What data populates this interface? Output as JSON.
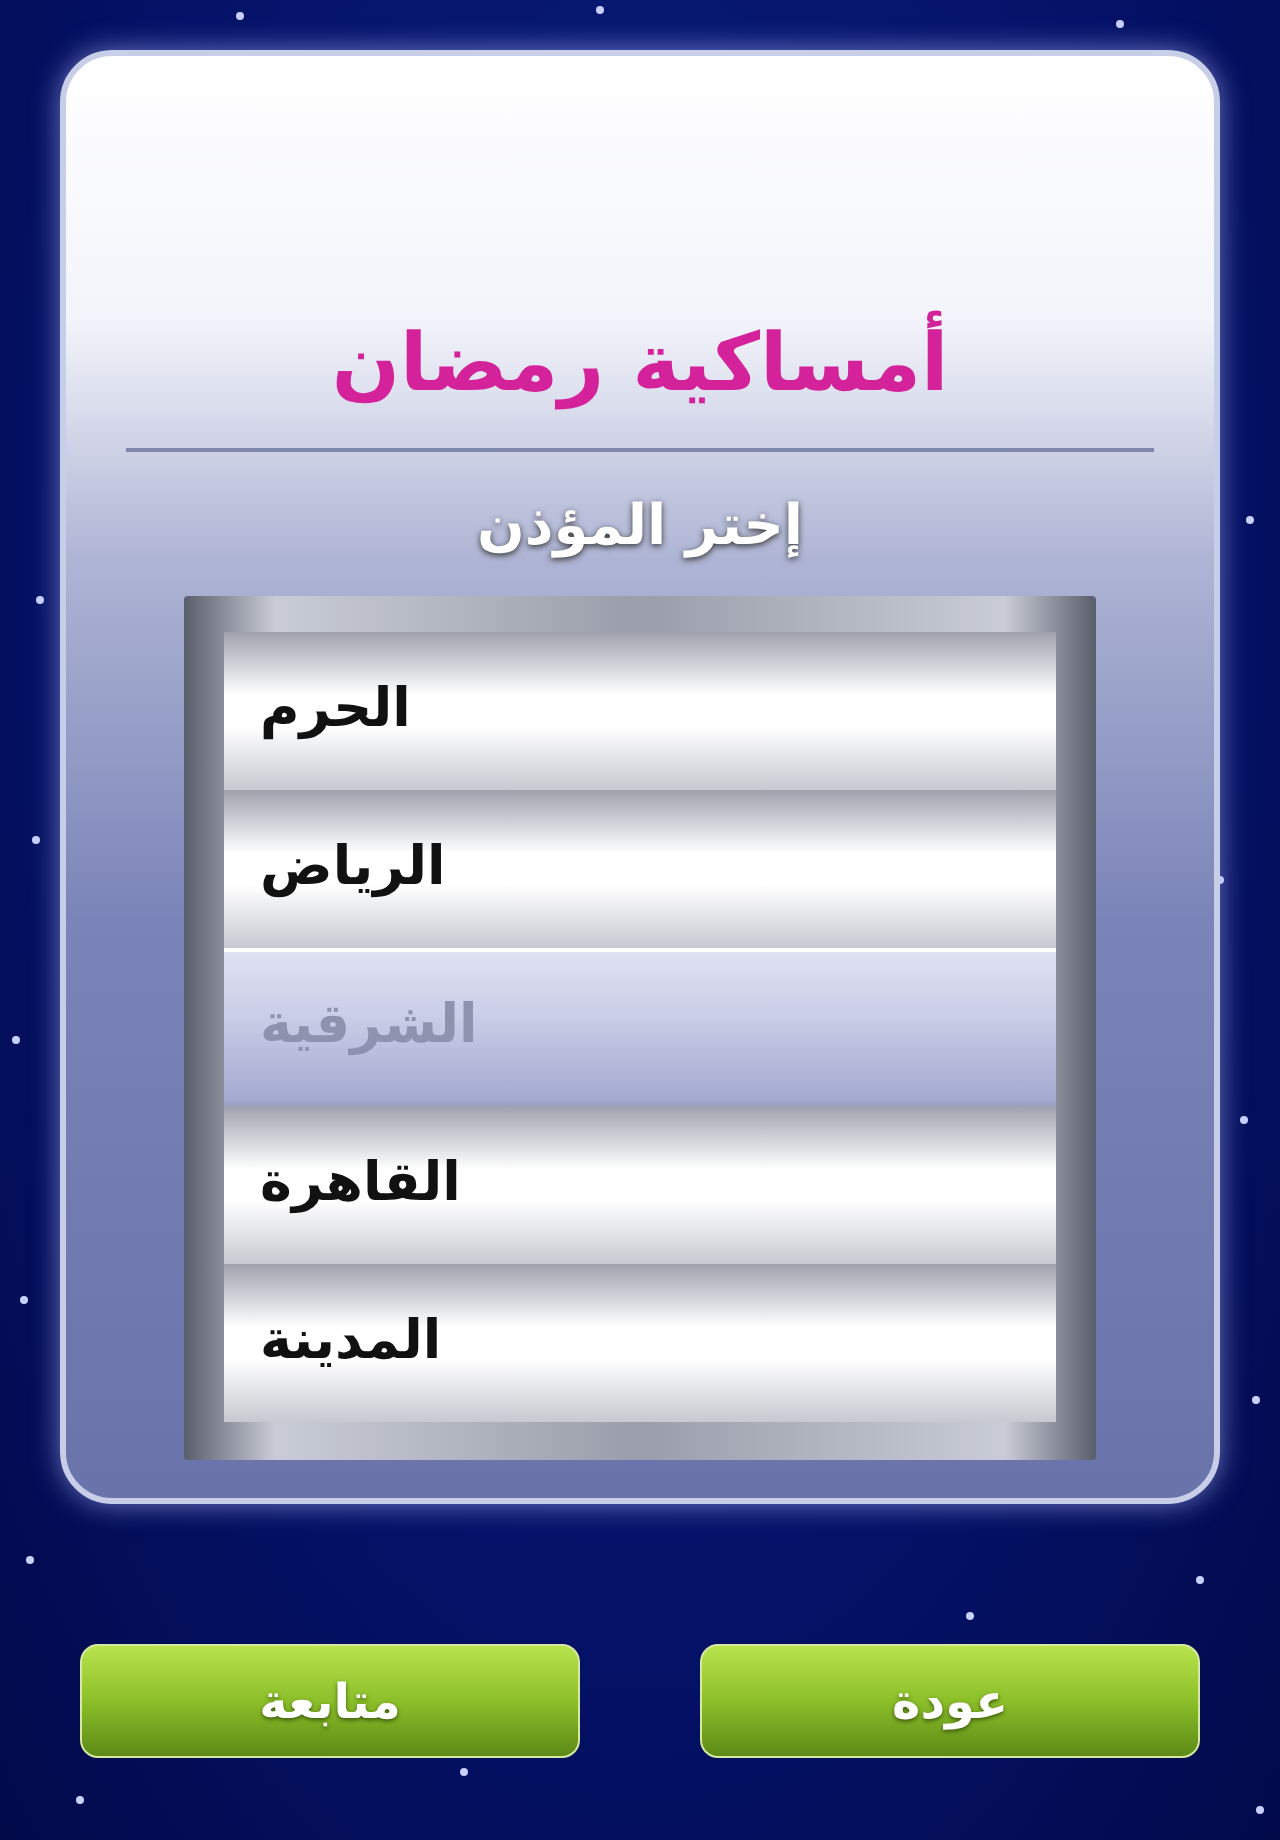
{
  "title": "أمساكية رمضان",
  "subtitle": "إختر المؤذن",
  "picker": [
    {
      "label": "الحرم",
      "selected": false
    },
    {
      "label": "الرياض",
      "selected": false
    },
    {
      "label": "الشرقية",
      "selected": true
    },
    {
      "label": "القاهرة",
      "selected": false
    },
    {
      "label": "المدينة",
      "selected": false
    }
  ],
  "buttons": [
    {
      "label": "عودة"
    },
    {
      "label": "متابعة"
    }
  ]
}
